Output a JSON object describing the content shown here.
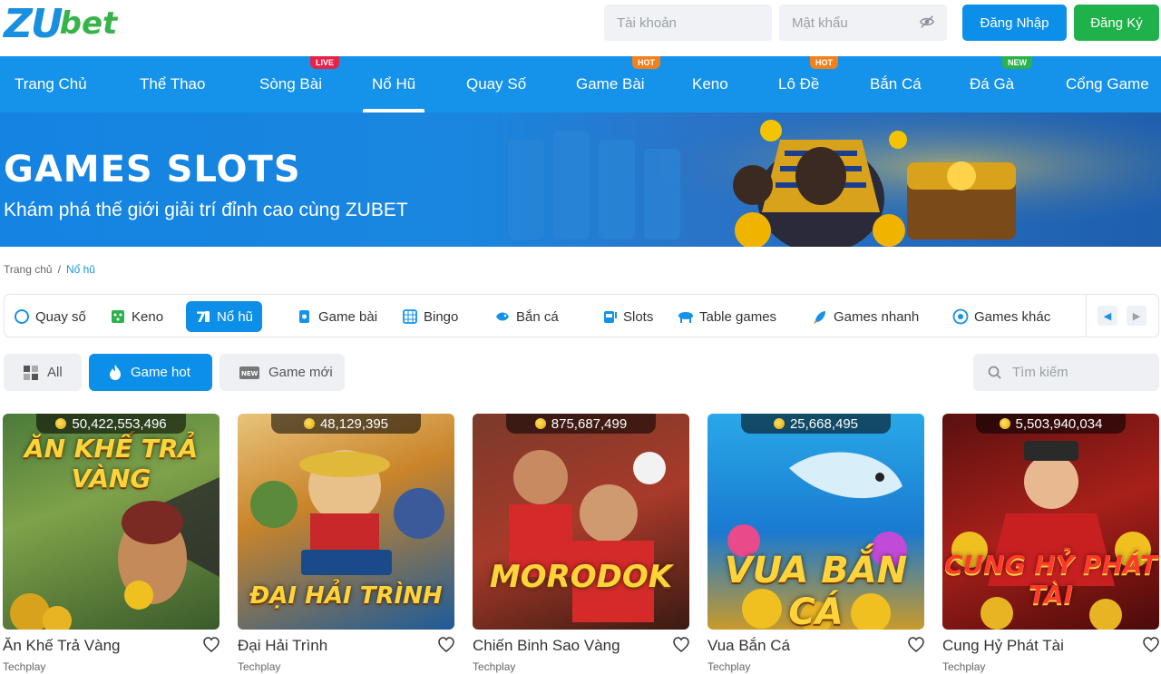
{
  "brand": {
    "logo_z": "ZU",
    "logo_bet": "bet"
  },
  "header": {
    "username_placeholder": "Tài khoản",
    "password_placeholder": "Mật khẩu",
    "login_label": "Đăng Nhập",
    "register_label": "Đăng Ký"
  },
  "nav": {
    "items": [
      {
        "label": "Trang Chủ"
      },
      {
        "label": "Thể Thao"
      },
      {
        "label": "Sòng Bài",
        "tag": "LIVE"
      },
      {
        "label": "Nổ Hũ"
      },
      {
        "label": "Quay Số"
      },
      {
        "label": "Game Bài",
        "tag": "HOT"
      },
      {
        "label": "Keno"
      },
      {
        "label": "Lô Đề",
        "tag": "HOT"
      },
      {
        "label": "Bắn Cá"
      },
      {
        "label": "Đá Gà",
        "tag": "NEW"
      },
      {
        "label": "Cổng Game"
      }
    ]
  },
  "banner": {
    "title": "GAMES SLOTS",
    "subtitle": "Khám phá thế giới giải trí đỉnh cao cùng ZUBET"
  },
  "breadcrumb": {
    "home": "Trang chủ",
    "sep": "/",
    "current": "Nổ hũ"
  },
  "categories": {
    "items": [
      {
        "label": "Quay số",
        "icon": "lottery-icon"
      },
      {
        "label": "Keno",
        "icon": "keno-icon"
      },
      {
        "label": "Nổ hũ",
        "icon": "slot-icon"
      },
      {
        "label": "Game bài",
        "icon": "cards-icon"
      },
      {
        "label": "Bingo",
        "icon": "bingo-icon"
      },
      {
        "label": "Bắn cá",
        "icon": "fish-icon"
      },
      {
        "label": "Slots",
        "icon": "slot-machine-icon"
      },
      {
        "label": "Table games",
        "icon": "table-icon"
      },
      {
        "label": "Games nhanh",
        "icon": "rocket-icon"
      },
      {
        "label": "Games khác",
        "icon": "ball-icon"
      }
    ]
  },
  "filters": {
    "all_label": "All",
    "hot_label": "Game hot",
    "new_label": "Game mới",
    "search_placeholder": "Tìm kiếm"
  },
  "games": [
    {
      "name": "Ăn Khế Trả Vàng",
      "provider": "Techplay",
      "jackpot": "50,422,553,496",
      "art": "ĂN KHẾ TRẢ VÀNG"
    },
    {
      "name": "Đại Hải Trình",
      "provider": "Techplay",
      "jackpot": "48,129,395",
      "art": "ĐẠI HẢI TRÌNH"
    },
    {
      "name": "Chiến Binh Sao Vàng",
      "provider": "Techplay",
      "jackpot": "875,687,499",
      "art": "MORODOK"
    },
    {
      "name": "Vua Bắn Cá",
      "provider": "Techplay",
      "jackpot": "25,668,495",
      "art": "VUA BẮN CÁ"
    },
    {
      "name": "Cung Hỷ Phát Tài",
      "provider": "Techplay",
      "jackpot": "5,503,940,034",
      "art": "CUNG HỶ PHÁT TÀI"
    }
  ],
  "colors": {
    "primary": "#1592ea",
    "green": "#1fb14a",
    "live": "#e5234a",
    "hot": "#f0811f",
    "new": "#2bb24c"
  }
}
